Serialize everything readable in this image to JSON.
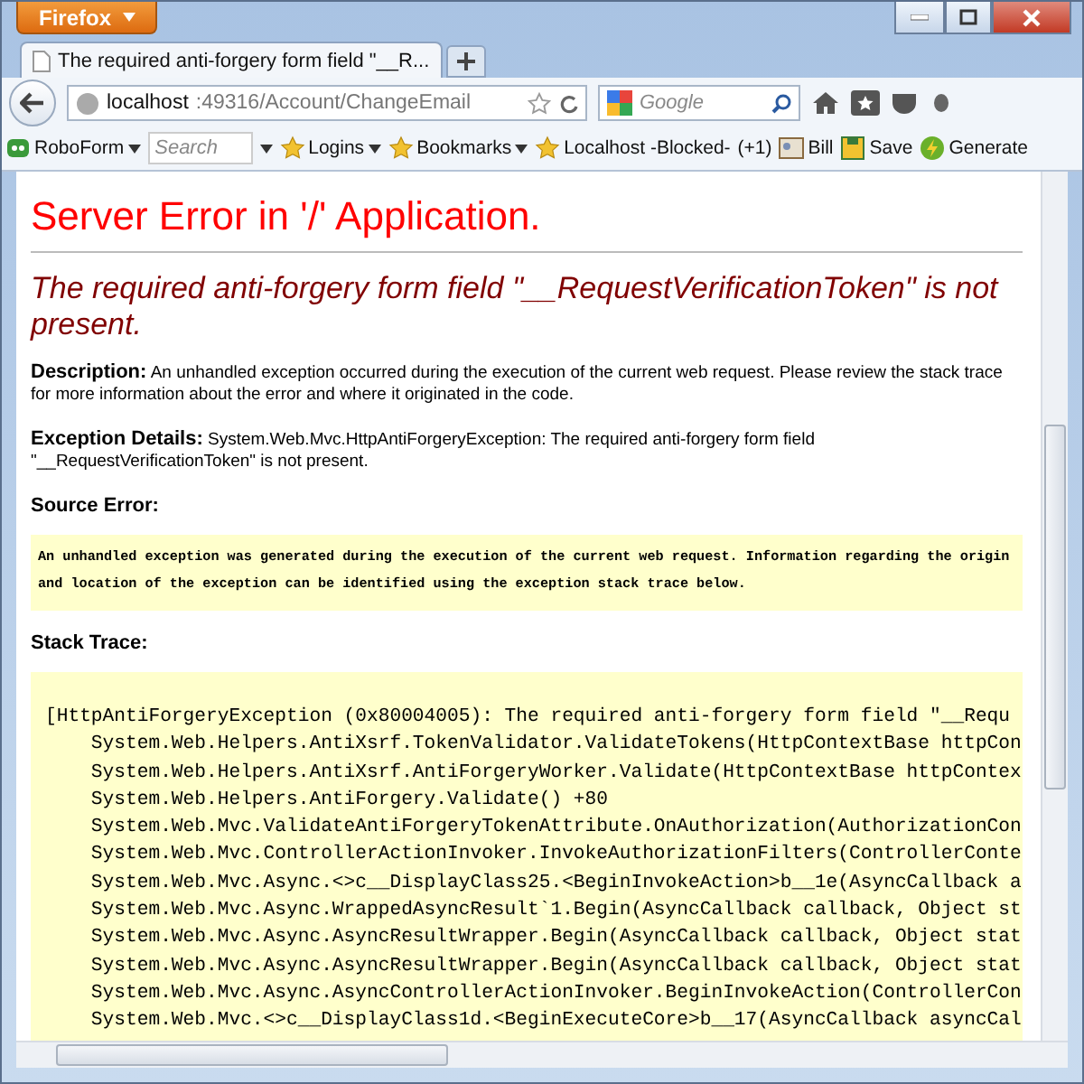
{
  "browser": {
    "menu_button": "Firefox",
    "tabs": [
      {
        "title": "The required anti-forgery form field \"__R...",
        "selected": true
      }
    ],
    "address": {
      "host": "localhost",
      "path": ":49316/Account/ChangeEmail"
    },
    "search": {
      "placeholder": "Google"
    },
    "bookmarks": [
      {
        "label": "RoboForm",
        "kind": "menu"
      },
      {
        "placeholder": "Search",
        "kind": "field"
      },
      {
        "label": "Logins",
        "kind": "menu"
      },
      {
        "label": "Bookmarks",
        "kind": "menu"
      },
      {
        "label": "Localhost -Blocked-",
        "kind": "link"
      },
      {
        "label": "(+1)",
        "kind": "text"
      },
      {
        "label": "Bill",
        "kind": "link"
      },
      {
        "label": "Save",
        "kind": "link"
      },
      {
        "label": "Generate",
        "kind": "link"
      }
    ]
  },
  "page": {
    "title": "Server Error in '/' Application.",
    "error_heading": "The required anti-forgery form field \"__RequestVerificationToken\" is not present.",
    "description": {
      "label": "Description:",
      "text": "An unhandled exception occurred during the execution of the current web request. Please review the stack trace for more information about the error and where it originated in the code."
    },
    "exception_details": {
      "label": "Exception Details:",
      "text": "System.Web.Mvc.HttpAntiForgeryException: The required anti-forgery form field \"__RequestVerificationToken\" is not present."
    },
    "source_error": {
      "label": "Source Error:",
      "text": "An unhandled exception was generated during the execution of the current web request. Information regarding the origin and location of the exception can be identified using the exception stack trace below."
    },
    "stack_trace": {
      "label": "Stack Trace:",
      "lines": [
        "[HttpAntiForgeryException (0x80004005): The required anti-forgery form field \"__Requ",
        "    System.Web.Helpers.AntiXsrf.TokenValidator.ValidateTokens(HttpContextBase httpCon",
        "    System.Web.Helpers.AntiXsrf.AntiForgeryWorker.Validate(HttpContextBase httpContex",
        "    System.Web.Helpers.AntiForgery.Validate() +80",
        "    System.Web.Mvc.ValidateAntiForgeryTokenAttribute.OnAuthorization(AuthorizationCon",
        "    System.Web.Mvc.ControllerActionInvoker.InvokeAuthorizationFilters(ControllerConte",
        "    System.Web.Mvc.Async.<>c__DisplayClass25.<BeginInvokeAction>b__1e(AsyncCallback a",
        "    System.Web.Mvc.Async.WrappedAsyncResult`1.Begin(AsyncCallback callback, Object st",
        "    System.Web.Mvc.Async.AsyncResultWrapper.Begin(AsyncCallback callback, Object stat",
        "    System.Web.Mvc.Async.AsyncResultWrapper.Begin(AsyncCallback callback, Object stat",
        "    System.Web.Mvc.Async.AsyncControllerActionInvoker.BeginInvokeAction(ControllerCon",
        "    System.Web.Mvc.<>c__DisplayClass1d.<BeginExecuteCore>b__17(AsyncCallback asyncCal"
      ]
    }
  }
}
